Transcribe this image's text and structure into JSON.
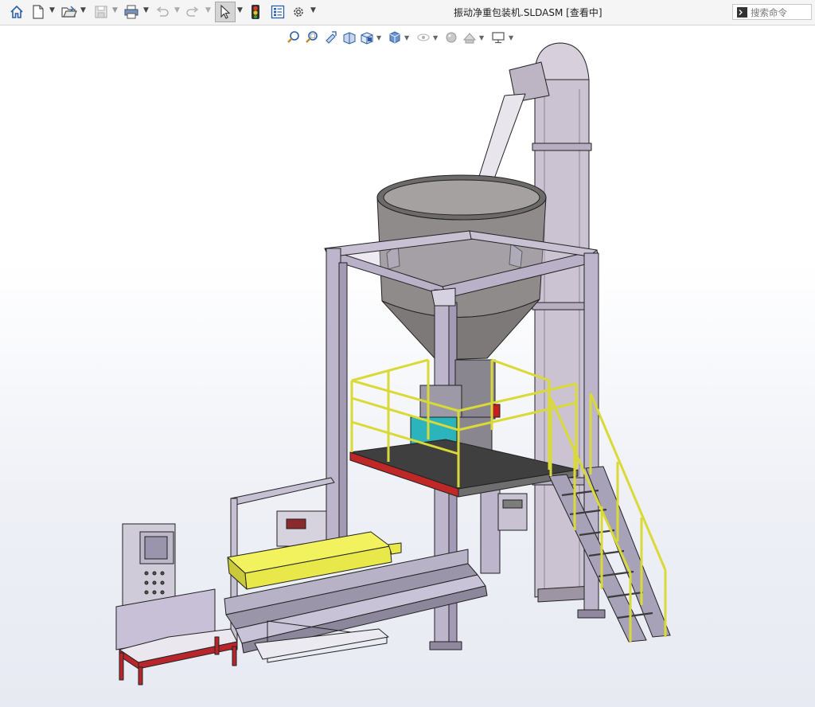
{
  "window": {
    "title": "振动净重包装机.SLDASM [查看中]"
  },
  "toolbar": {
    "items": [
      {
        "name": "home-button",
        "icon": "home-icon"
      },
      {
        "name": "new-document-button",
        "icon": "new-document-icon"
      },
      {
        "name": "open-button",
        "icon": "open-folder-icon"
      },
      {
        "name": "save-button",
        "icon": "save-icon",
        "state": "disabled"
      },
      {
        "name": "print-button",
        "icon": "print-icon"
      },
      {
        "name": "undo-button",
        "icon": "undo-icon",
        "state": "disabled"
      },
      {
        "name": "redo-button",
        "icon": "redo-icon",
        "state": "disabled"
      },
      {
        "name": "select-button",
        "icon": "cursor-arrow-icon",
        "state": "active"
      },
      {
        "name": "rebuild-button",
        "icon": "traffic-light-icon"
      },
      {
        "name": "file-properties-button",
        "icon": "properties-icon"
      },
      {
        "name": "options-button",
        "icon": "gear-icon"
      }
    ]
  },
  "search": {
    "placeholder": "搜索命令",
    "value": "",
    "icon": "command-prompt-icon"
  },
  "heads_up_toolbar": {
    "items": [
      "zoom-to-fit-icon",
      "zoom-to-area-icon",
      "previous-view-icon",
      "section-view-icon",
      "view-orientation-icon",
      "display-style-icon",
      "hide-show-items-icon",
      "edit-appearance-icon",
      "apply-scene-icon",
      "view-settings-icon"
    ]
  },
  "colors": {
    "frame": "#b3aec6",
    "hopper": "#8f8b8a",
    "elevator": "#c4bbca",
    "railing": "#e2e23a",
    "platform": "#3f3f3f",
    "platform_edge": "#c02828",
    "sealer": "#e8e84a",
    "scale_box": "#2cb4bc",
    "table_red": "#b8262c",
    "accent_select": "#d4d4d4"
  },
  "model": {
    "name": "振动净重包装机.SLDASM"
  }
}
